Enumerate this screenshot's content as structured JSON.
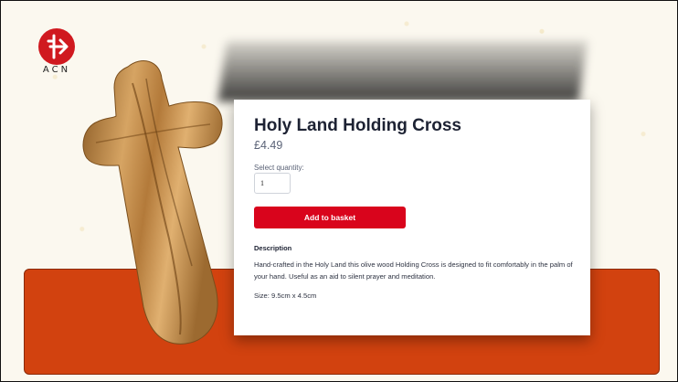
{
  "brand": {
    "logo_text": "ACN",
    "accent": "#d0191f"
  },
  "product": {
    "title": "Holy Land Holding Cross",
    "price": "£4.49",
    "quantity_label": "Select quantity:",
    "quantity_value": "1",
    "add_button_label": "Add to basket",
    "description_heading": "Description",
    "description": "Hand-crafted in the Holy Land this olive wood Holding Cross is designed to fit comfortably in the palm of your hand. Useful as an aid to silent prayer and meditation.",
    "size": "Size: 9.5cm x 4.5cm"
  },
  "colors": {
    "button": "#d9041c",
    "band": "#d2420f",
    "background": "#fbf8ef"
  }
}
